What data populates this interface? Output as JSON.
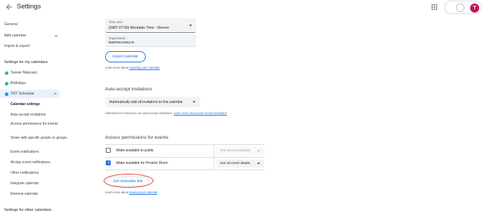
{
  "header": {
    "title": "Settings"
  },
  "sidebar": {
    "general": "General",
    "add_calendar": "Add calendar",
    "import_export": "Import & export",
    "my_calendars_heading": "Settings for my calendars",
    "calendars": [
      {
        "label": "Tanner Mascaro",
        "color": "#33b679"
      },
      {
        "label": "Birthdays",
        "color": "#33b679"
      },
      {
        "label": "TRT Schedule",
        "color": "#039be5"
      }
    ],
    "subitems": [
      "Calendar settings",
      "Auto-accept invitations",
      "Access permissions for events",
      "Share with specific people or groups",
      "Event notifications",
      "All-day event notifications",
      "Other notifications",
      "Integrate calendar",
      "Remove calendar"
    ],
    "other_calendars_heading": "Settings for other calendars"
  },
  "main": {
    "timezone": {
      "label": "Time zone",
      "value": "(GMT-07:00) Mountain Time - Denver"
    },
    "organization": {
      "label": "Organization",
      "value": "teamrecovery.io"
    },
    "export_button": "Export calendar",
    "export_note_prefix": "Learn more about ",
    "export_note_link": "exporting your calendar",
    "auto_accept": {
      "title": "Auto-accept invitations",
      "select_value": "Automatically add all invitations to this calendar",
      "note_prefix": "Calendars for resources can auto-accept invitations. ",
      "note_link": "Learn more about auto-accept invitations"
    },
    "access": {
      "title": "Access permissions for events",
      "rows": [
        {
          "label": "Make available to public",
          "checked": false,
          "select": "See all event details",
          "disabled": true
        },
        {
          "label": "Make available for Preston Dixon",
          "checked": true,
          "select": "See all event details",
          "disabled": false
        }
      ],
      "share_link_button": "Get shareable link",
      "note_prefix": "Learn more about ",
      "note_link": "sharing your calendar"
    }
  },
  "colors": {
    "accent": "#1a73e8",
    "highlight": "#e8f0fe",
    "annotation": "#e53935",
    "avatar": "#c2185b"
  },
  "account": {
    "avatar_letter": "T"
  }
}
